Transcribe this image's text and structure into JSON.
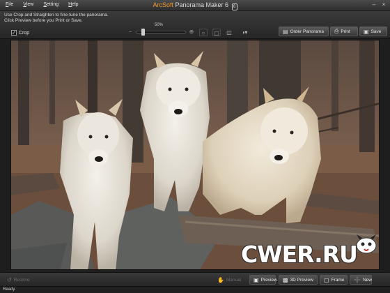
{
  "window": {
    "menu": [
      "File",
      "View",
      "Setting",
      "Help"
    ],
    "brand": "ArcSoft",
    "title": "Panorama Maker 6",
    "version_badge": "6"
  },
  "toolbar": {
    "hint_line1": "Use Crop and Straighten to fine-tune the panorama.",
    "hint_line2": "Click Preview before you Print or Save.",
    "crop_label": "Crop",
    "crop_checked": true,
    "zoom_label": "50%",
    "zoom_value": 0.5,
    "order_label": "Order Panorama",
    "print_label": "Print",
    "save_label": "Save"
  },
  "bottom": {
    "restore_label": "Restore",
    "manual_label": "Manual",
    "preview_label": "Preview",
    "preview3d_label": "3D Preview",
    "frame_label": "Frame",
    "new_label": "New"
  },
  "watermark": {
    "text": "CWER.RU"
  },
  "status": {
    "text": "Ready."
  },
  "icons": {
    "zoom_out": "zoom-out-icon",
    "zoom_in": "zoom-in-icon",
    "order": "order-panorama-icon",
    "print": "printer-icon",
    "save": "save-icon"
  },
  "colors": {
    "brand": "#f29a2e",
    "background": "#2b2b2b"
  }
}
